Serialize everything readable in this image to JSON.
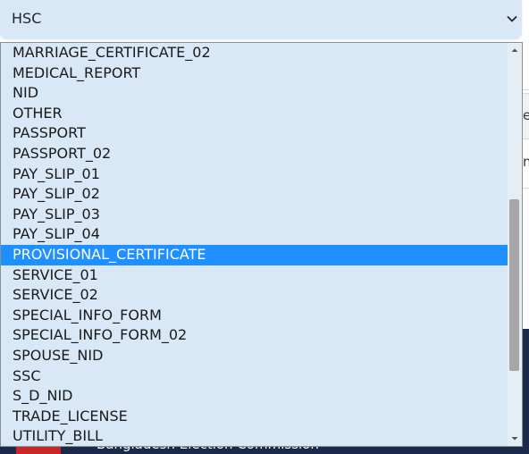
{
  "select": {
    "value": "HSC",
    "chevron_icon": "chevron-down-icon"
  },
  "dropdown": {
    "selected_index": 10,
    "options": [
      "MARRIAGE_CERTIFICATE_02",
      "MEDICAL_REPORT",
      "NID",
      "OTHER",
      "PASSPORT",
      "PASSPORT_02",
      "PAY_SLIP_01",
      "PAY_SLIP_02",
      "PAY_SLIP_03",
      "PAY_SLIP_04",
      "PROVISIONAL_CERTIFICATE",
      "SERVICE_01",
      "SERVICE_02",
      "SPECIAL_INFO_FORM",
      "SPECIAL_INFO_FORM_02",
      "SPOUSE_NID",
      "SSC",
      "S_D_NID",
      "TRADE_LICENSE",
      "UTILITY_BILL"
    ],
    "scroll_position": 0.7
  },
  "background": {
    "footer_text": "Bangladesh Election Commission",
    "partial_header_glyph": "er",
    "partial_row_glyph": "n"
  },
  "colors": {
    "select_bg": "#d9e8f7",
    "selected_bg": "#1e90ff",
    "footer_bg": "#1b2a4a"
  }
}
